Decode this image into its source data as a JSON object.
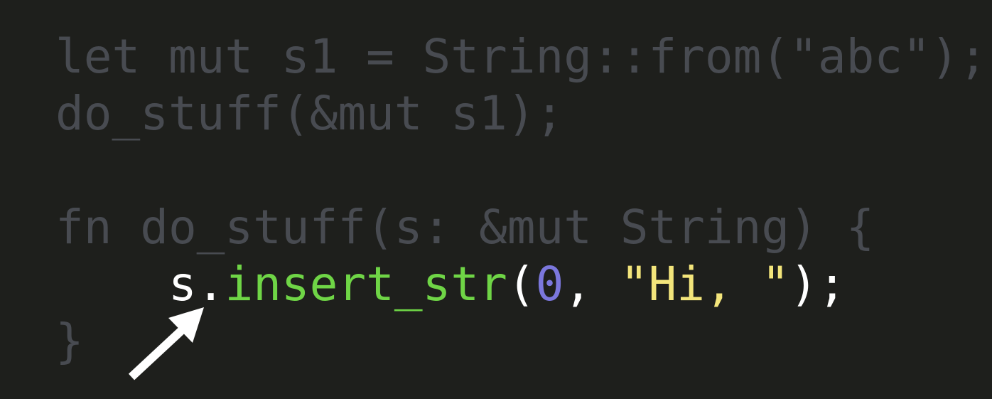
{
  "code": {
    "line1": "let mut s1 = String::from(\"abc\");",
    "line2": "do_stuff(&mut s1);",
    "line3": "",
    "line4": "fn do_stuff(s: &mut String) {",
    "line5": {
      "indent": "    ",
      "receiver": "s",
      "dot": ".",
      "method": "insert_str",
      "open_paren": "(",
      "arg_number": "0",
      "comma": ", ",
      "arg_string": "\"Hi, \"",
      "close": ");"
    },
    "line6": "}"
  },
  "colors": {
    "background": "#1e1f1c",
    "dimmed_text": "#484b51",
    "plain_text": "#ffffff",
    "method": "#6fd546",
    "number": "#7b77dc",
    "string": "#f3e57b",
    "arrow": "#ffffff"
  },
  "annotation": {
    "icon": "arrow-up-right-icon"
  }
}
